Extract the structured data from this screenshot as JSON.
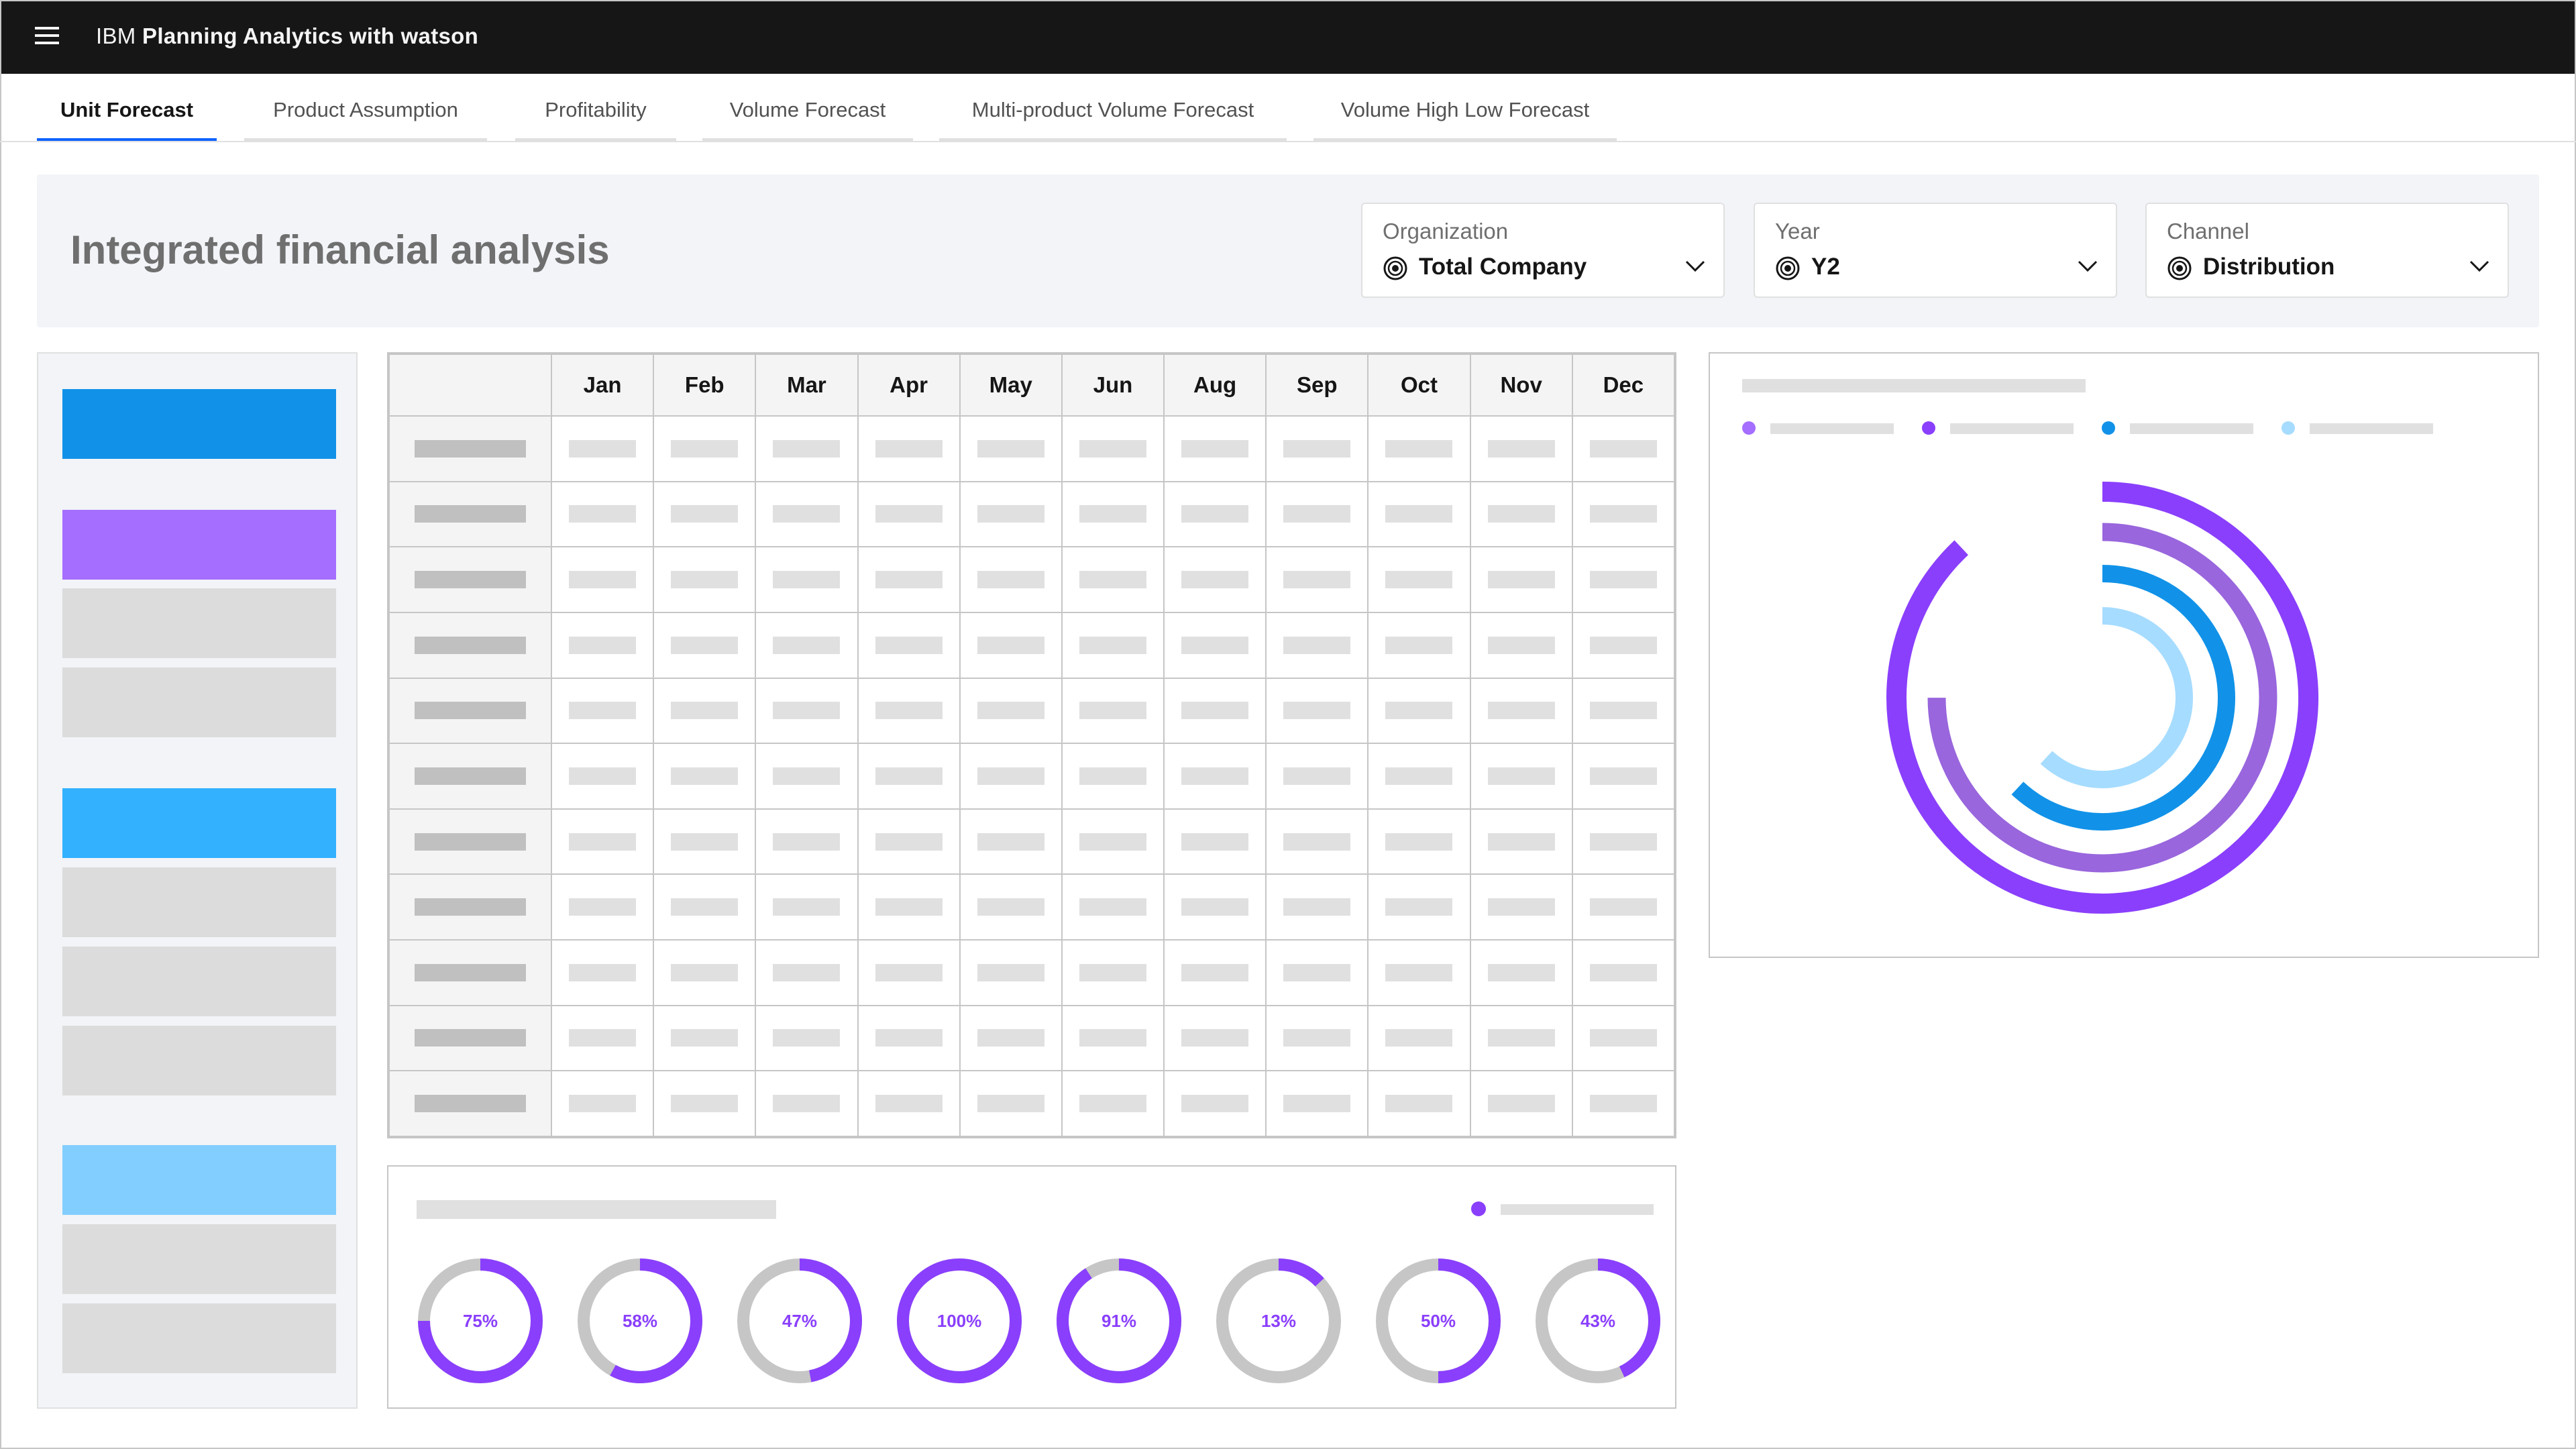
{
  "app": {
    "brand_prefix": "IBM",
    "brand_name": "Planning Analytics with watson"
  },
  "tabs": [
    {
      "label": "Unit Forecast",
      "active": true
    },
    {
      "label": "Product Assumption",
      "active": false
    },
    {
      "label": "Profitability",
      "active": false
    },
    {
      "label": "Volume Forecast",
      "active": false
    },
    {
      "label": "Multi-product Volume Forecast",
      "active": false
    },
    {
      "label": "Volume High Low Forecast",
      "active": false
    }
  ],
  "header": {
    "title": "Integrated financial analysis",
    "filters": {
      "organization": {
        "label": "Organization",
        "value": "Total Company"
      },
      "year": {
        "label": "Year",
        "value": "Y2"
      },
      "channel": {
        "label": "Channel",
        "value": "Distribution"
      }
    }
  },
  "left_panel": {
    "block_colors": [
      "#1192e8",
      "#a56eff",
      "#33b1ff",
      "#82cfff",
      "#dcdcdc"
    ]
  },
  "table": {
    "months": [
      "Jan",
      "Feb",
      "Mar",
      "Apr",
      "May",
      "Jun",
      "Aug",
      "Sep",
      "Oct",
      "Nov",
      "Dec"
    ],
    "row_count": 11
  },
  "radial_chart": {
    "legend_colors": [
      "#a56eff",
      "#8a3ffc",
      "#1192e8",
      "#a6dcff"
    ],
    "rings": [
      {
        "color": "#8a3ffc",
        "fraction": 0.88
      },
      {
        "color": "#9966dd",
        "fraction": 0.75
      },
      {
        "color": "#1192e8",
        "fraction": 0.62
      },
      {
        "color": "#a6dcff",
        "fraction": 0.62
      }
    ]
  },
  "donuts": {
    "accent_color": "#8a3ffc",
    "track_color": "#c6c6c6",
    "items": [
      {
        "label": "75%",
        "value": 75
      },
      {
        "label": "58%",
        "value": 58
      },
      {
        "label": "47%",
        "value": 47
      },
      {
        "label": "100%",
        "value": 100
      },
      {
        "label": "91%",
        "value": 91
      },
      {
        "label": "13%",
        "value": 13
      },
      {
        "label": "50%",
        "value": 50
      },
      {
        "label": "43%",
        "value": 43
      }
    ]
  }
}
